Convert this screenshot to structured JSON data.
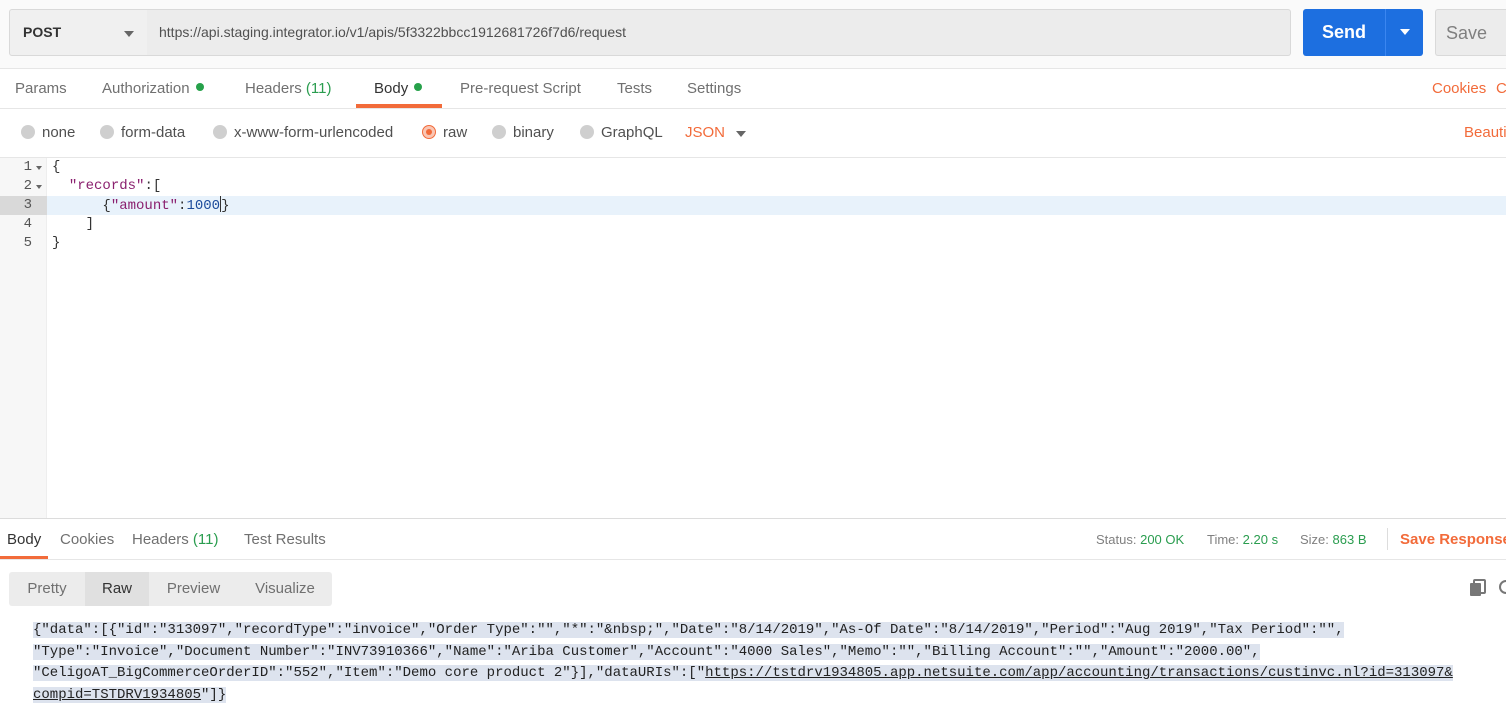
{
  "request": {
    "method": "POST",
    "url": "https://api.staging.integrator.io/v1/apis/5f3322bbcc1912681726f7d6/request",
    "send_label": "Send",
    "save_label": "Save"
  },
  "tabs": {
    "params": "Params",
    "authorization": "Authorization",
    "headers": "Headers",
    "headers_count": "(11)",
    "body": "Body",
    "prerequest": "Pre-request Script",
    "tests": "Tests",
    "settings": "Settings",
    "cookies": "Cookies",
    "code_partial": "C"
  },
  "body_types": {
    "none": "none",
    "form_data": "form-data",
    "urlencoded": "x-www-form-urlencoded",
    "raw": "raw",
    "binary": "binary",
    "graphql": "GraphQL",
    "language": "JSON",
    "beautify_partial": "Beauti"
  },
  "editor": {
    "line_numbers": [
      "1",
      "2",
      "3",
      "4",
      "5"
    ],
    "lines": {
      "l1": "{",
      "l2_key": "\"records\"",
      "l2_rest": ":[",
      "l3_open": "{",
      "l3_key": "\"amount\"",
      "l3_colon": ":",
      "l3_value": "1000",
      "l3_close": "}",
      "l4": "]",
      "l5": "}"
    }
  },
  "response": {
    "tabs": {
      "body": "Body",
      "cookies": "Cookies",
      "headers": "Headers",
      "headers_count": "(11)",
      "test_results": "Test Results"
    },
    "status_label": "Status:",
    "status_value": "200 OK",
    "time_label": "Time:",
    "time_value": "2.20 s",
    "size_label": "Size:",
    "size_value": "863 B",
    "save_response": "Save Response",
    "view_modes": {
      "pretty": "Pretty",
      "raw": "Raw",
      "preview": "Preview",
      "visualize": "Visualize"
    },
    "raw_lines": {
      "line1": "{\"data\":[{\"id\":\"313097\",\"recordType\":\"invoice\",\"Order Type\":\"\",\"*\":\"&nbsp;\",\"Date\":\"8/14/2019\",\"As-Of Date\":\"8/14/2019\",\"Period\":\"Aug 2019\",\"Tax Period\":\"\",",
      "line2": "\"Type\":\"Invoice\",\"Document Number\":\"INV73910366\",\"Name\":\"Ariba Customer\",\"Account\":\"4000 Sales\",\"Memo\":\"\",\"Billing Account\":\"\",\"Amount\":\"2000.00\",",
      "line3_pre": "\"CeligoAT_BigCommerceOrderID\":\"552\",\"Item\":\"Demo core product 2\"}],\"dataURIs\":[\"",
      "line3_link": "https://tstdrv1934805.app.netsuite.com/app/accounting/transactions/custinvc.nl?id=313097&",
      "line4_link": "compid=TSTDRV1934805",
      "line4_post": "\"]}"
    }
  },
  "colors": {
    "accent": "#f26b3a",
    "send": "#1d6fe0",
    "success": "#2a9d4f"
  }
}
